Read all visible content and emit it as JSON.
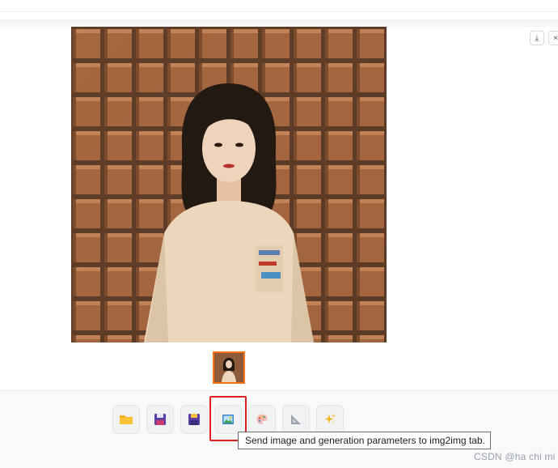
{
  "gallery": {
    "download_icon": "download-icon",
    "close_icon": "close-icon",
    "close_glyph": "×",
    "download_glyph": "⤓",
    "thumbnail_selected_color": "#f97316"
  },
  "toolbar": {
    "buttons": [
      {
        "icon": "folder-icon",
        "tooltip": ""
      },
      {
        "icon": "save-icon",
        "tooltip": ""
      },
      {
        "icon": "zip-save-icon",
        "tooltip": ""
      },
      {
        "icon": "image-icon",
        "tooltip": "Send image and generation parameters to img2img tab."
      },
      {
        "icon": "palette-icon",
        "tooltip": ""
      },
      {
        "icon": "triangle-ruler-icon",
        "tooltip": ""
      },
      {
        "icon": "sparkles-icon",
        "tooltip": ""
      }
    ],
    "highlight_color": "#e0201f"
  },
  "tooltip": {
    "text": "Send image and generation parameters to img2img tab."
  },
  "watermark": {
    "text": "CSDN @ha chi mi"
  }
}
